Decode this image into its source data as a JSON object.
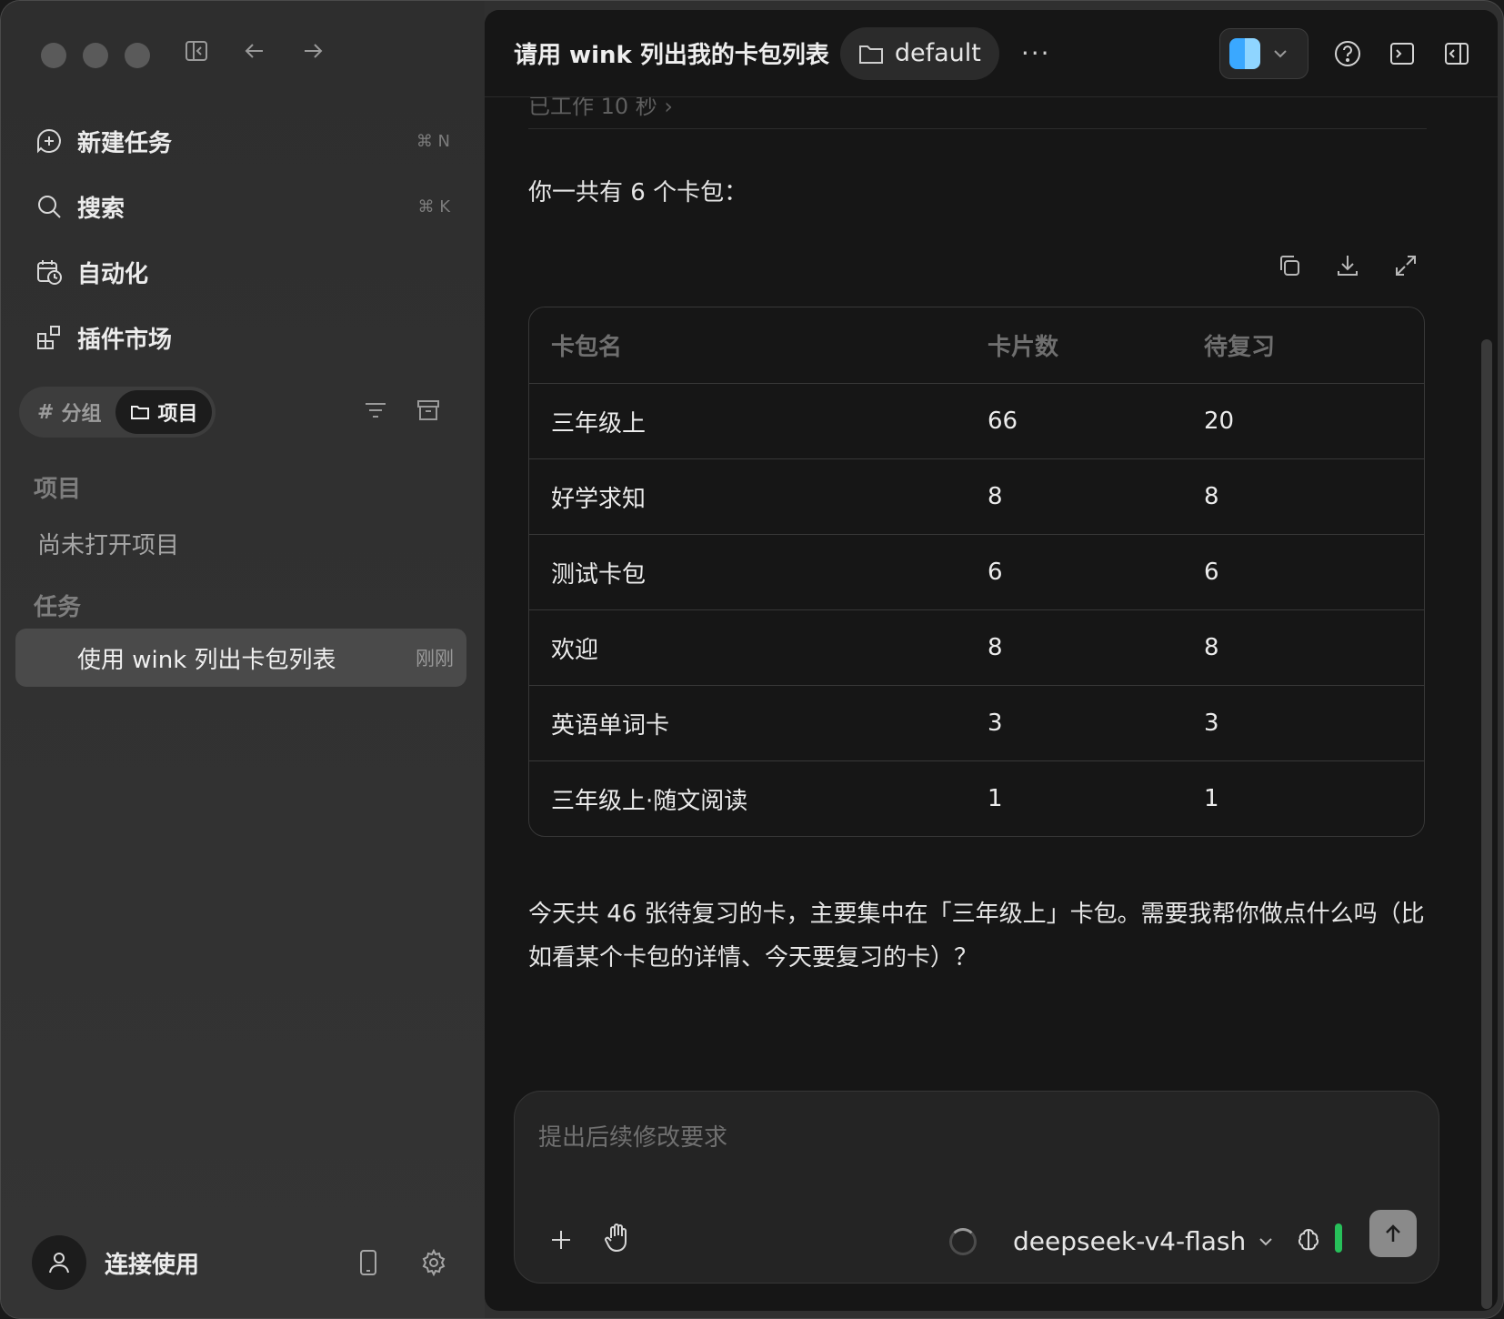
{
  "sidebar": {
    "nav": [
      {
        "label": "新建任务",
        "shortcut": "⌘ N",
        "icon": "new-task-icon"
      },
      {
        "label": "搜索",
        "shortcut": "⌘ K",
        "icon": "search-icon"
      },
      {
        "label": "自动化",
        "shortcut": "",
        "icon": "calendar-clock-icon"
      },
      {
        "label": "插件市场",
        "shortcut": "",
        "icon": "plugin-icon"
      }
    ],
    "segment": {
      "group_label": "分组",
      "project_label": "项目"
    },
    "projects_title": "项目",
    "no_project": "尚未打开项目",
    "tasks_title": "任务",
    "task": {
      "title": "使用 wink 列出卡包列表",
      "time": "刚刚"
    },
    "user_label": "连接使用"
  },
  "header": {
    "title": "请用 wink 列出我的卡包列表",
    "folder": "default",
    "more": "···"
  },
  "content": {
    "cut_text": "已工作 10 秒  ›",
    "intro": "你一共有 6 个卡包：",
    "table": {
      "headers": [
        "卡包名",
        "卡片数",
        "待复习"
      ],
      "rows": [
        [
          "三年级上",
          "66",
          "20"
        ],
        [
          "好学求知",
          "8",
          "8"
        ],
        [
          "测试卡包",
          "6",
          "6"
        ],
        [
          "欢迎",
          "8",
          "8"
        ],
        [
          "英语单词卡",
          "3",
          "3"
        ],
        [
          "三年级上·随文阅读",
          "1",
          "1"
        ]
      ]
    },
    "answer": "今天共 46 张待复习的卡，主要集中在「三年级上」卡包。需要我帮你做点什么吗（比如看某个卡包的详情、今天要复习的卡）？"
  },
  "composer": {
    "placeholder": "提出后续修改要求",
    "model": "deepseek-v4-flash"
  },
  "colors": {
    "accent_green": "#27c05a",
    "finder_blue": "#3aa8ff"
  }
}
